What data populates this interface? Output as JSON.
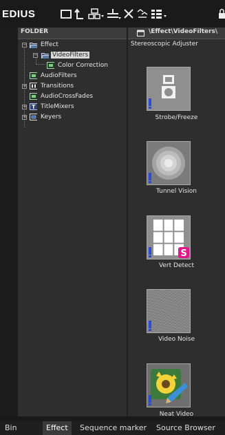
{
  "app": {
    "brand": "EDIUS"
  },
  "toolbar": {
    "icons": [
      "new-bin-icon",
      "up-folder-icon",
      "view-tree-icon",
      "sort-icon",
      "delete-icon",
      "properties-icon",
      "view-mode-icon",
      "lock-icon"
    ]
  },
  "folder_panel": {
    "header": "FOLDER",
    "items": [
      {
        "label": "Effect",
        "icon": "folder-open-icon",
        "expanded": true
      },
      {
        "label": "VideoFilters",
        "icon": "folder-open-icon",
        "selected": true
      },
      {
        "label": "Color Correction",
        "icon": "filter-icon"
      },
      {
        "label": "AudioFilters",
        "icon": "filter-icon"
      },
      {
        "label": "Transitions",
        "icon": "transition-icon"
      },
      {
        "label": "AudioCrossFades",
        "icon": "filter-icon"
      },
      {
        "label": "TitleMixers",
        "icon": "title-icon"
      },
      {
        "label": "Keyers",
        "icon": "keyer-icon"
      }
    ]
  },
  "content_panel": {
    "path": "\\Effect\\VideoFilters\\",
    "top_item": "Stereoscopic Adjuster",
    "items": [
      {
        "label": "Strobe/Freeze",
        "icon": "camera-icon"
      },
      {
        "label": "Tunnel Vision",
        "icon": "tunnel-icon"
      },
      {
        "label": "Vert Detect",
        "icon": "grid-icon",
        "badge": "S"
      },
      {
        "label": "Video Noise",
        "icon": "noise-icon"
      },
      {
        "label": "Neat Video",
        "icon": "neat-video-icon"
      }
    ]
  },
  "tabs": [
    {
      "label": "Bin"
    },
    {
      "label": "Effect",
      "active": true
    },
    {
      "label": "Sequence marker"
    },
    {
      "label": "Source Browser"
    }
  ]
}
